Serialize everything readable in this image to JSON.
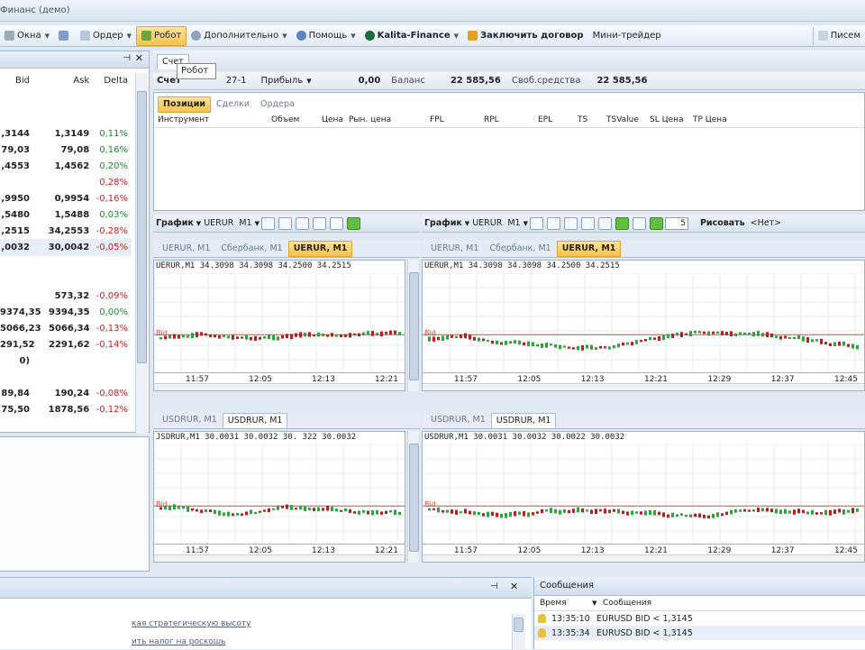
{
  "window": {
    "title": "Финанс (демо)"
  },
  "menu": {
    "items": [
      {
        "label": "Окна",
        "icon": "windows-icon",
        "dropdown": true
      },
      {
        "label": "",
        "icon": "layout-icon",
        "dropdown": false
      },
      {
        "label": "Ордер",
        "icon": "order-icon",
        "dropdown": true
      },
      {
        "label": "Робот",
        "icon": "robot-icon",
        "dropdown": false,
        "active": true
      },
      {
        "label": "Дополнительно",
        "icon": "extra-icon",
        "dropdown": true
      },
      {
        "label": "Помощь",
        "icon": "help-icon",
        "dropdown": true
      },
      {
        "label": "Kalita-Finance",
        "icon": "kalita-logo-icon",
        "dropdown": true,
        "bold": true
      },
      {
        "label": "Заключить договор",
        "icon": "contract-icon",
        "dropdown": false,
        "bold": true
      },
      {
        "label": "Мини-трейдер",
        "icon": "",
        "dropdown": false
      }
    ],
    "right_label": "Писем"
  },
  "tooltip": {
    "text": "Робот"
  },
  "quotes": {
    "columns": [
      "Bid",
      "Ask",
      "Delta"
    ],
    "rows": [
      {
        "bid": ",3144",
        "ask": "1,3149",
        "delta": "0,11%",
        "dir": "pos"
      },
      {
        "bid": "79,03",
        "ask": "79,08",
        "delta": "0,16%",
        "dir": "pos"
      },
      {
        "bid": ",4553",
        "ask": "1,4562",
        "delta": "0,20%",
        "dir": "pos"
      },
      {
        "bid": "",
        "ask": "",
        "delta": "0,28%",
        "dir": "neg"
      },
      {
        "bid": ",9950",
        "ask": "0,9954",
        "delta": "-0,16%",
        "dir": "neg"
      },
      {
        "bid": ",5480",
        "ask": "1,5488",
        "delta": "0,03%",
        "dir": "pos"
      },
      {
        "bid": ",2515",
        "ask": "34,2553",
        "delta": "-0,28%",
        "dir": "neg"
      },
      {
        "bid": ",0032",
        "ask": "30,0042",
        "delta": "-0,05%",
        "dir": "neg"
      },
      {
        "bid": "",
        "ask": "",
        "delta": "",
        "dir": ""
      },
      {
        "bid": "",
        "ask": "",
        "delta": "",
        "dir": ""
      },
      {
        "bid": "",
        "ask": "573,32",
        "delta": "-0,09%",
        "dir": "neg"
      },
      {
        "bid": "9374,35",
        "ask": "9394,35",
        "delta": "0,00%",
        "dir": "pos"
      },
      {
        "bid": "5066,23",
        "ask": "5066,34",
        "delta": "-0,13%",
        "dir": "neg"
      },
      {
        "bid": "291,52",
        "ask": "2291,62",
        "delta": "-0,14%",
        "dir": "neg"
      },
      {
        "bid": "0)",
        "ask": "",
        "delta": "",
        "dir": ""
      },
      {
        "bid": "",
        "ask": "",
        "delta": "",
        "dir": ""
      },
      {
        "bid": "89,84",
        "ask": "190,24",
        "delta": "-0,08%",
        "dir": "neg"
      },
      {
        "bid": "75,50",
        "ask": "1878,56",
        "delta": "-0,12%",
        "dir": "neg"
      },
      {
        "bid": "",
        "ask": "",
        "delta": "",
        "dir": ""
      }
    ]
  },
  "account": {
    "tab": "Счет",
    "account_label": "Счет",
    "account_value": "27-1",
    "profit_label": "Прибыль",
    "profit_value": "0,00",
    "balance_label": "Баланс",
    "balance_value": "22 585,56",
    "free_label": "Своб.средства",
    "free_value": "22 585,56",
    "tabs": [
      "Позиции",
      "Сделки",
      "Ордера"
    ],
    "columns": [
      "Инструмент",
      "Объем",
      "Цена",
      "Рын. цена",
      "FPL",
      "RPL",
      "EPL",
      "TS",
      "TSValue",
      "SL Цена",
      "TP Цена"
    ]
  },
  "chart_toolbar": {
    "left": {
      "label": "График",
      "symbol": "UERUR",
      "tf": "M1"
    },
    "right": {
      "label": "График",
      "symbol": "UERUR",
      "tf": "M1",
      "count": "5",
      "draw_label": "Рисовать",
      "none_label": "<Нет>"
    }
  },
  "charts": {
    "top_tabs": [
      "UERUR, M1",
      "Сбербанк, M1",
      "UERUR, M1"
    ],
    "bottom_tabs": [
      "USDRUR, M1",
      "USDRUR, M1"
    ],
    "top_left_ohlc": "UERUR,M1  34.3098  34.3098  34.2500  34.2515",
    "top_right_ohlc": "UERUR,M1  34.3098  34.3098  34.2500  34.2515",
    "bottom_left_ohlc": "JSDRUR,M1  30.0031  30.0032  30.  322  30.0032",
    "bottom_right_ohlc": "USDRUR,M1  30.0031  30.0032  30.0022  30.0032",
    "bid_label": "Bid",
    "times_top_left": [
      "11:57",
      "12:05",
      "12:13",
      "12:21"
    ],
    "times_top_right": [
      "11:57",
      "12:05",
      "12:13",
      "12:21",
      "12:29",
      "12:37",
      "12:45"
    ],
    "times_bottom_left": [
      "11:57",
      "12:05",
      "12:13",
      "12:21"
    ],
    "times_bottom_right": [
      "11:57",
      "12:05",
      "12:13",
      "12:21",
      "12:29",
      "12:37",
      "12:45"
    ]
  },
  "news": {
    "links": [
      "кая стратегическую высоту",
      "ить налог на роскошь"
    ]
  },
  "messages": {
    "title": "Сообщения",
    "col_time": "Время",
    "col_msg": "Сообщения",
    "rows": [
      {
        "time": "13:35:10",
        "text": "EURUSD BID < 1,3145"
      },
      {
        "time": "13:35:34",
        "text": "EURUSD BID < 1,3145"
      }
    ]
  },
  "colors": {
    "positive": "#1a8a2a",
    "negative": "#c8201e",
    "accent": "#f6c24a",
    "bid_line": "#d24a3a"
  }
}
